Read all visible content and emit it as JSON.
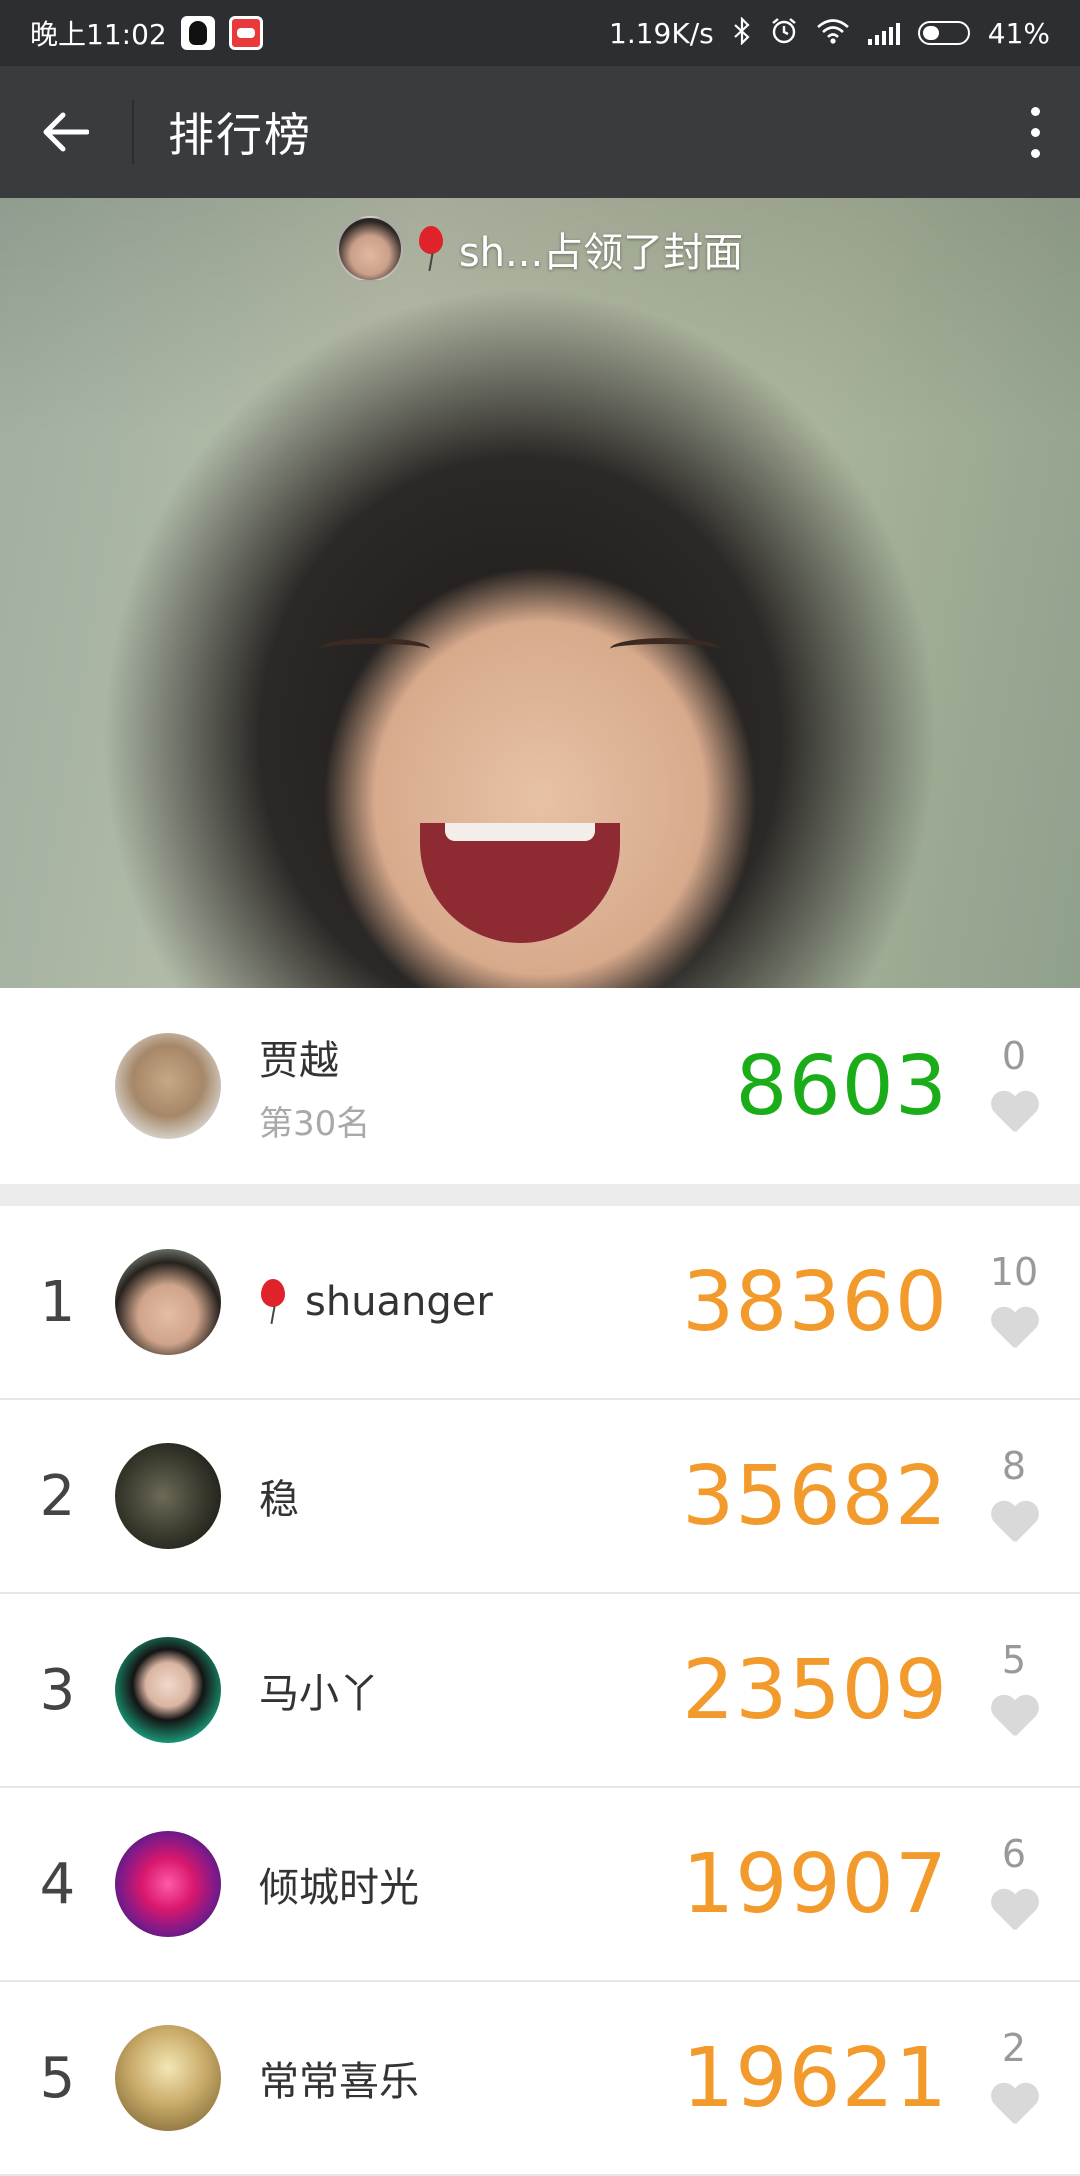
{
  "status_bar": {
    "time": "晚上11:02",
    "net_speed": "1.19K/s",
    "battery_percent": "41%",
    "icons": [
      "qq-icon",
      "car-app-icon",
      "bluetooth-icon",
      "alarm-icon",
      "wifi-icon",
      "signal-icon",
      "battery-icon"
    ]
  },
  "app_bar": {
    "title": "排行榜",
    "back_icon": "arrow-left-icon",
    "more_icon": "more-vertical-icon"
  },
  "cover": {
    "text": "sh...占领了封面",
    "badge_icon": "balloon-icon"
  },
  "my_entry": {
    "name": "贾越",
    "rank": "第30名",
    "score": "8603",
    "likes": "0",
    "score_color": "#1aad19"
  },
  "ranking": [
    {
      "rank": "1",
      "name": "shuanger",
      "score": "38360",
      "likes": "10",
      "has_balloon": true
    },
    {
      "rank": "2",
      "name": "稳",
      "score": "35682",
      "likes": "8"
    },
    {
      "rank": "3",
      "name": "马小丫",
      "score": "23509",
      "likes": "5"
    },
    {
      "rank": "4",
      "name": "倾城时光",
      "score": "19907",
      "likes": "6"
    },
    {
      "rank": "5",
      "name": "常常喜乐",
      "score": "19621",
      "likes": "2"
    }
  ],
  "colors": {
    "ranking_score": "#f29b2c",
    "heart_inactive": "#d9d9d9",
    "app_bar": "#3a3b3f"
  }
}
